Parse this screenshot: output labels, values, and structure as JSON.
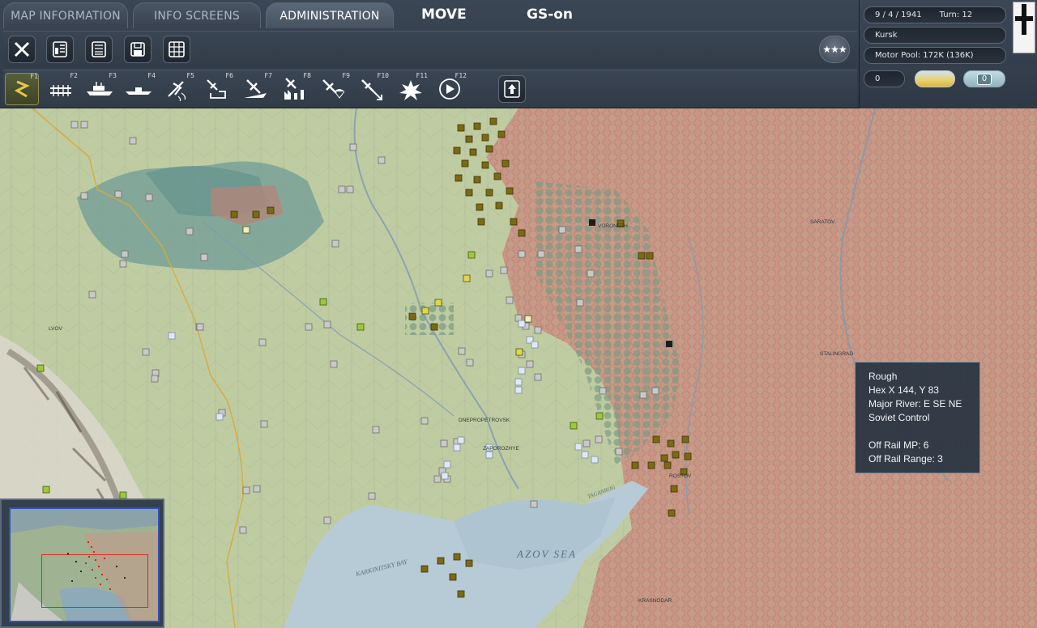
{
  "tabs": [
    {
      "label": "MAP INFORMATION",
      "active": false
    },
    {
      "label": "INFO SCREENS",
      "active": false
    },
    {
      "label": "ADMINISTRATION",
      "active": true
    }
  ],
  "header": {
    "mode": "MOVE",
    "gs_status": "GS-on"
  },
  "toolbar_row1": [
    {
      "name": "close-button",
      "icon": "close-icon"
    },
    {
      "name": "unit-list-button",
      "icon": "list-panel-icon"
    },
    {
      "name": "reports-button",
      "icon": "report-list-icon"
    },
    {
      "name": "save-button",
      "icon": "floppy-disk-icon"
    },
    {
      "name": "grid-view-button",
      "icon": "grid-icon"
    }
  ],
  "function_keys": [
    {
      "key": "F1",
      "icon": "move-mode-icon",
      "selected": true
    },
    {
      "key": "F2",
      "icon": "rail-mode-icon"
    },
    {
      "key": "F3",
      "icon": "naval-transport-icon"
    },
    {
      "key": "F4",
      "icon": "naval-move-icon"
    },
    {
      "key": "F5",
      "icon": "air-recon-icon"
    },
    {
      "key": "F6",
      "icon": "air-transfer-icon"
    },
    {
      "key": "F7",
      "icon": "ground-attack-icon"
    },
    {
      "key": "F8",
      "icon": "airfield-bombing-icon"
    },
    {
      "key": "F9",
      "icon": "airborne-drop-icon"
    },
    {
      "key": "F10",
      "icon": "air-interdiction-icon"
    },
    {
      "key": "F11",
      "icon": "city-bombing-icon"
    },
    {
      "key": "F12",
      "icon": "end-phase-icon"
    }
  ],
  "upload_icon": "eject-icon",
  "rating_icon": "three-stars-icon",
  "rating_text": "★★★",
  "status": {
    "date": "9 / 4 / 1941",
    "turn": "Turn: 12",
    "location": "Kursk",
    "motor_pool": "Motor Pool:  172K (136K)",
    "counter_left": "0",
    "counter_right": "0"
  },
  "flag_icon": "iron-cross-flag-icon",
  "tooltip": {
    "terrain": "Rough",
    "hex": "Hex X 144, Y 83",
    "river": "Major River: E SE NE",
    "control": "Soviet Control",
    "mp": "Off Rail MP: 6",
    "range": "Off Rail Range: 3"
  },
  "map_labels": {
    "sea": "AZOV SEA",
    "bay": "KARKINITSKY BAY",
    "gulf": "TAGANROG",
    "city1": "DNEPROPETROVSK",
    "city2": "ZAPOROZHYE",
    "city3": "SARATOV",
    "city4": "KRASNODAR",
    "city5": "LVOV",
    "city6": "VORONEZH",
    "city7": "ROSTOV",
    "city8": "STALINGRAD"
  },
  "colors": {
    "soviet_zone": "#c99586",
    "axis_unit": "#7a6a12",
    "soviet_unit": "#c8c8c8",
    "allied_unit": "#9dc83a",
    "sea": "#b7cbd6"
  }
}
